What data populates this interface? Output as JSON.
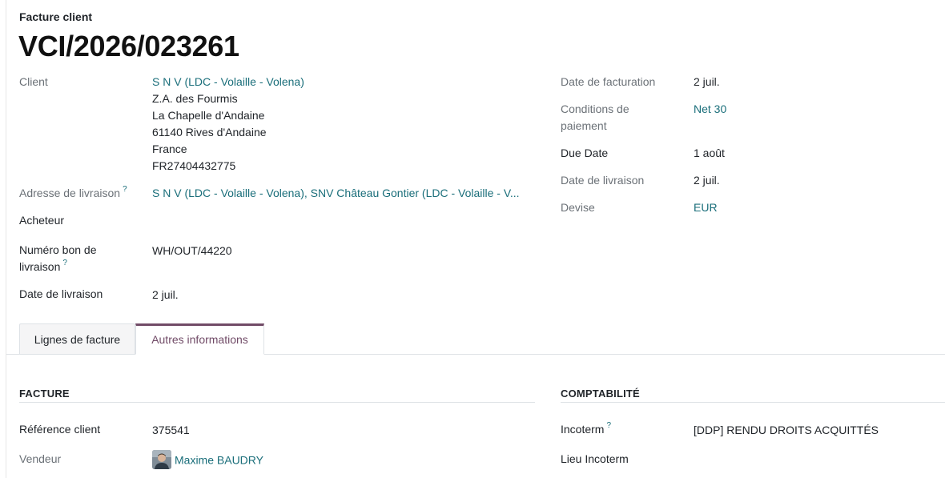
{
  "header": {
    "doc_type": "Facture client",
    "number": "VCI/2026/023261"
  },
  "left": {
    "client_label": "Client",
    "client_name": "S N V (LDC - Volaille - Volena)",
    "address_lines": [
      "Z.A. des Fourmis",
      "La Chapelle d'Andaine",
      "61140 Rives d'Andaine",
      "France",
      "FR27404432775"
    ],
    "delivery_address_label": "Adresse de livraison",
    "delivery_address_value": "S N V (LDC - Volaille - Volena), SNV Château Gontier (LDC - Volaille - V...",
    "buyer_label": "Acheteur",
    "delivery_note_label_1": "Numéro bon de",
    "delivery_note_label_2": "livraison",
    "delivery_note_value": "WH/OUT/44220",
    "delivery_date_label": "Date de livraison",
    "delivery_date_value": "2 juil."
  },
  "right": {
    "invoice_date_label": "Date de facturation",
    "invoice_date_value": "2 juil.",
    "payment_terms_label_1": "Conditions de",
    "payment_terms_label_2": "paiement",
    "payment_terms_value": "Net 30",
    "due_date_label": "Due Date",
    "due_date_value": "1 août",
    "delivery_date_label": "Date de livraison",
    "delivery_date_value": "2 juil.",
    "currency_label": "Devise",
    "currency_value": "EUR"
  },
  "help_mark": "?",
  "tabs": {
    "lines": "Lignes de facture",
    "other": "Autres informations"
  },
  "invoice_section": {
    "title": "FACTURE",
    "customer_ref_label": "Référence client",
    "customer_ref_value": "375541",
    "salesperson_label": "Vendeur",
    "salesperson_value": "Maxime BAUDRY"
  },
  "accounting_section": {
    "title": "COMPTABILITÉ",
    "incoterm_label": "Incoterm",
    "incoterm_value": "[DDP] RENDU DROITS ACQUITTÉS",
    "incoterm_place_label": "Lieu Incoterm"
  },
  "colors": {
    "link": "#1a6e7a",
    "active_tab": "#714b67"
  }
}
